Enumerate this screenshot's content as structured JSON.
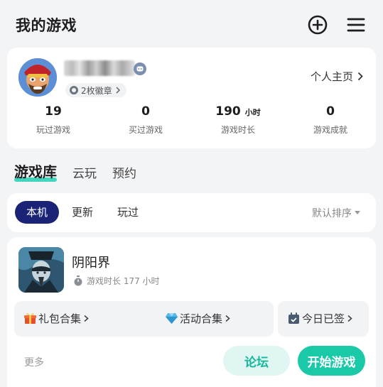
{
  "header": {
    "title": "我的游戏",
    "add_icon": "plus-circle-icon",
    "menu_icon": "hamburger-menu-icon"
  },
  "profile": {
    "badge_count_label": "2枚徽章",
    "homepage_label": "个人主页",
    "stats": [
      {
        "value": "19",
        "unit": "",
        "label": "玩过游戏"
      },
      {
        "value": "0",
        "unit": "",
        "label": "买过游戏"
      },
      {
        "value": "190",
        "unit": "小时",
        "label": "游戏时长"
      },
      {
        "value": "0",
        "unit": "",
        "label": "游戏成就"
      }
    ]
  },
  "tabs": [
    {
      "label": "游戏库",
      "active": true
    },
    {
      "label": "云玩",
      "active": false
    },
    {
      "label": "预约",
      "active": false
    }
  ],
  "filters": {
    "chips": [
      {
        "label": "本机",
        "active": true
      },
      {
        "label": "更新",
        "active": false
      },
      {
        "label": "玩过",
        "active": false
      }
    ],
    "sort_label": "默认排序"
  },
  "game": {
    "title": "阴阳界",
    "playtime": "游戏时长 177 小时",
    "gift_label": "礼包合集",
    "activity_label": "活动合集",
    "checkin_label": "今日已签",
    "more_label": "更多",
    "forum_label": "论坛",
    "start_label": "开始游戏"
  },
  "colors": {
    "accent": "#19c9a8",
    "chip_active": "#1b2377",
    "tab_underline": "#2ed3b7"
  }
}
